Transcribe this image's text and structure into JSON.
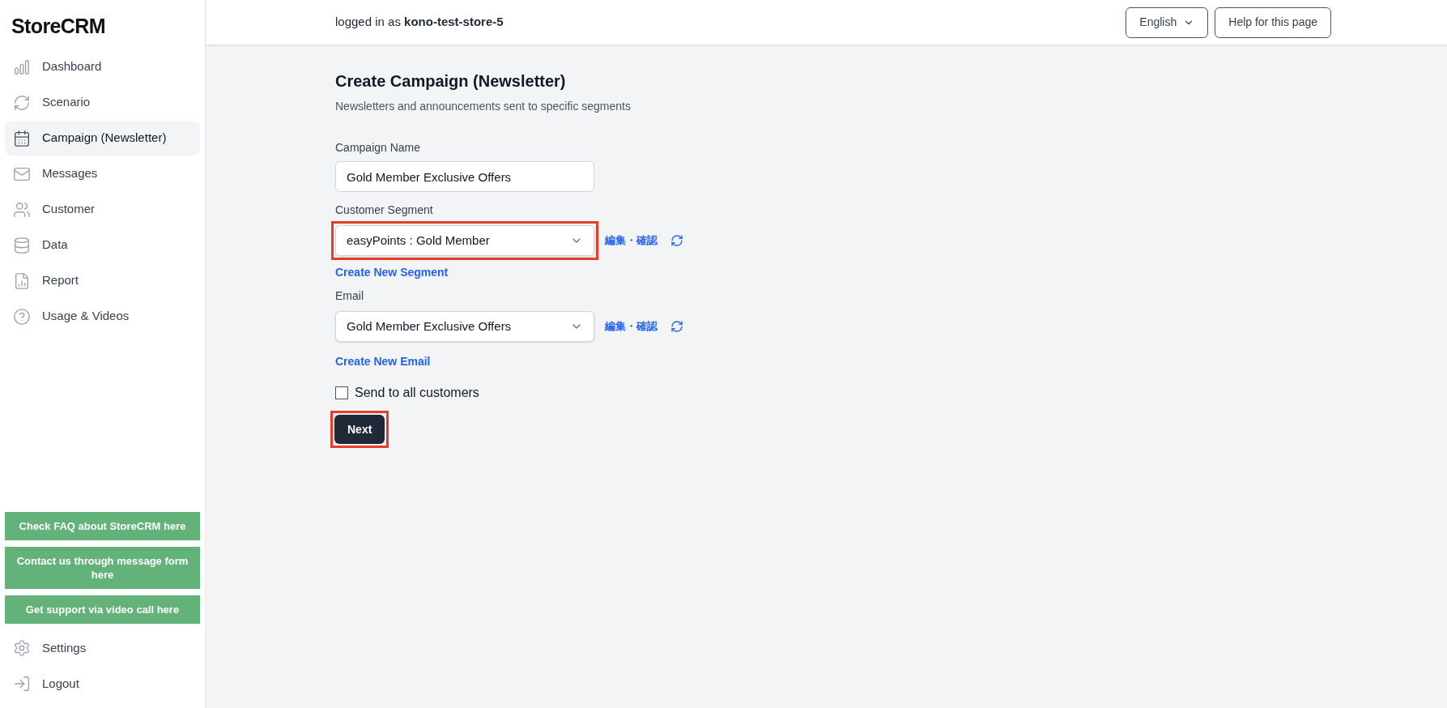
{
  "sidebar": {
    "logo": "StoreCRM",
    "items": [
      {
        "label": "Dashboard",
        "selected": false
      },
      {
        "label": "Scenario",
        "selected": false
      },
      {
        "label": "Campaign (Newsletter)",
        "selected": true
      },
      {
        "label": "Messages",
        "selected": false
      },
      {
        "label": "Customer",
        "selected": false
      },
      {
        "label": "Data",
        "selected": false
      },
      {
        "label": "Report",
        "selected": false
      },
      {
        "label": "Usage & Videos",
        "selected": false
      }
    ],
    "support_buttons": [
      "Check FAQ about StoreCRM here",
      "Contact us through message form here",
      "Get support via video call here"
    ],
    "bottom_items": [
      {
        "label": "Settings"
      },
      {
        "label": "Logout"
      }
    ]
  },
  "header": {
    "login_text": "logged in as **kono-test-store-5**",
    "language": "English",
    "help_button": "Help for this page"
  },
  "page": {
    "title": "Create Campaign (Newsletter)",
    "subtitle": "Newsletters and announcements sent to specific segments",
    "campaign_name": {
      "label": "Campaign Name",
      "value": "Gold Member Exclusive Offers"
    },
    "segment": {
      "label": "Customer Segment",
      "value": "easyPoints : Gold Member",
      "highlighted": true,
      "edit_link": "編集・確認",
      "create_link": "Create New Segment"
    },
    "email": {
      "label": "Email",
      "value": "Gold Member Exclusive Offers",
      "edit_link": "編集・確認",
      "create_link": "Create New Email"
    },
    "send_all": {
      "label": "Send to all customers",
      "checked": false
    },
    "next_button": {
      "label": "Next",
      "highlighted": true
    }
  }
}
